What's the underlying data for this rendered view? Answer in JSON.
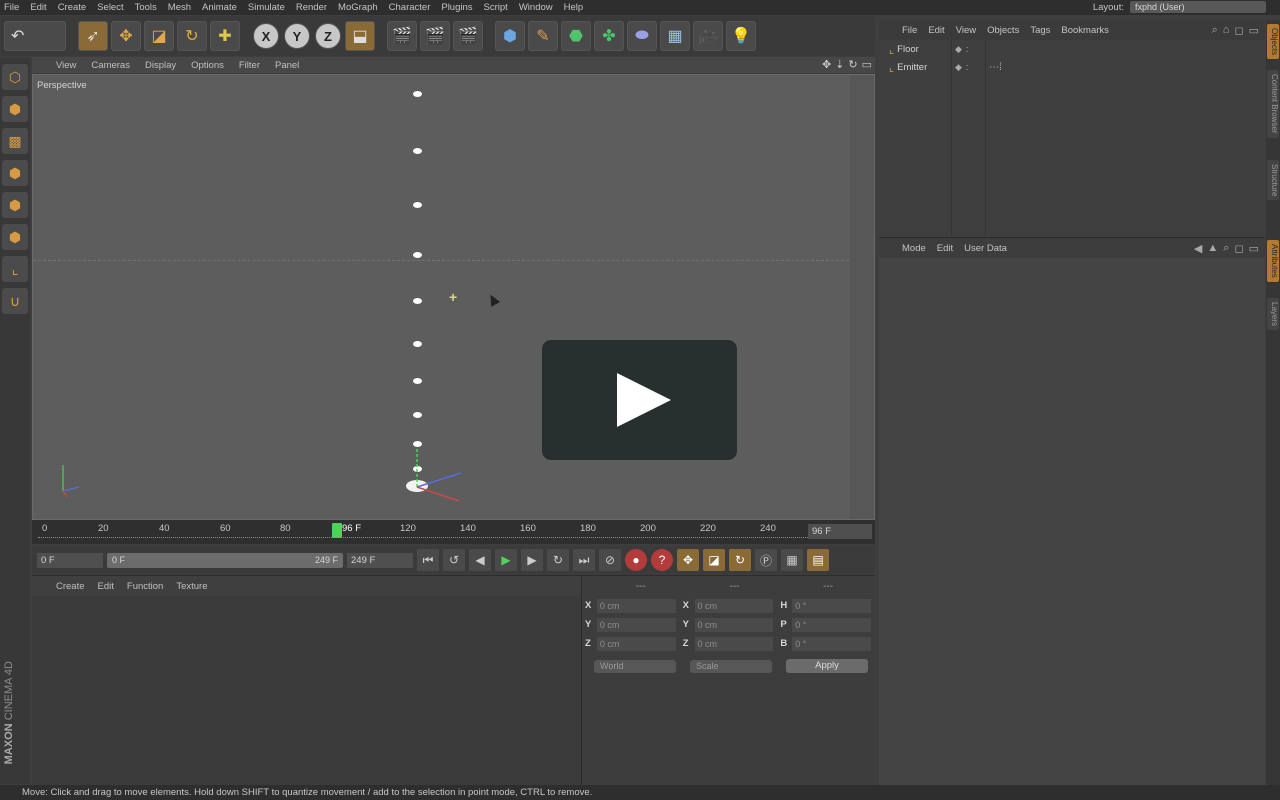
{
  "menubar": {
    "items": [
      "File",
      "Edit",
      "Create",
      "Select",
      "Tools",
      "Mesh",
      "Animate",
      "Simulate",
      "Render",
      "MoGraph",
      "Character",
      "Plugins",
      "Script",
      "Window",
      "Help"
    ],
    "layout_label": "Layout:",
    "layout_value": "fxphd (User)"
  },
  "viewport": {
    "menu": [
      "View",
      "Cameras",
      "Display",
      "Options",
      "Filter",
      "Panel"
    ],
    "label": "Perspective"
  },
  "timeline": {
    "ticks": [
      "0",
      "20",
      "40",
      "60",
      "80",
      "96 F",
      "120",
      "140",
      "160",
      "180",
      "200",
      "220",
      "240"
    ],
    "current_frame": "96 F"
  },
  "transport": {
    "start_field": "0 F",
    "range_start": "0 F",
    "range_end": "249 F",
    "end_field": "249 F"
  },
  "material_menu": [
    "Create",
    "Edit",
    "Function",
    "Texture"
  ],
  "coords": {
    "headers": [
      "---",
      "---",
      "---"
    ],
    "rows": [
      {
        "a": "X",
        "av": "0 cm",
        "b": "X",
        "bv": "0 cm",
        "c": "H",
        "cv": "0 °"
      },
      {
        "a": "Y",
        "av": "0 cm",
        "b": "Y",
        "bv": "0 cm",
        "c": "P",
        "cv": "0 °"
      },
      {
        "a": "Z",
        "av": "0 cm",
        "b": "Z",
        "bv": "0 cm",
        "c": "B",
        "cv": "0 °"
      }
    ],
    "mode_dropdown": "World",
    "scale_dropdown": "Scale",
    "apply_label": "Apply"
  },
  "objects": {
    "menu": [
      "File",
      "Edit",
      "View",
      "Objects",
      "Tags",
      "Bookmarks"
    ],
    "items": [
      {
        "name": "Floor"
      },
      {
        "name": "Emitter"
      }
    ]
  },
  "attributes": {
    "menu": [
      "Mode",
      "Edit",
      "User Data"
    ]
  },
  "right_tabs": [
    "Objects",
    "Content Browser",
    "Structure",
    "Attributes",
    "Layers"
  ],
  "brand": {
    "maker": "MAXON",
    "product": "CINEMA 4D"
  },
  "status": "Move: Click and drag to move elements. Hold down SHIFT to quantize movement / add to the selection in point mode, CTRL to remove."
}
